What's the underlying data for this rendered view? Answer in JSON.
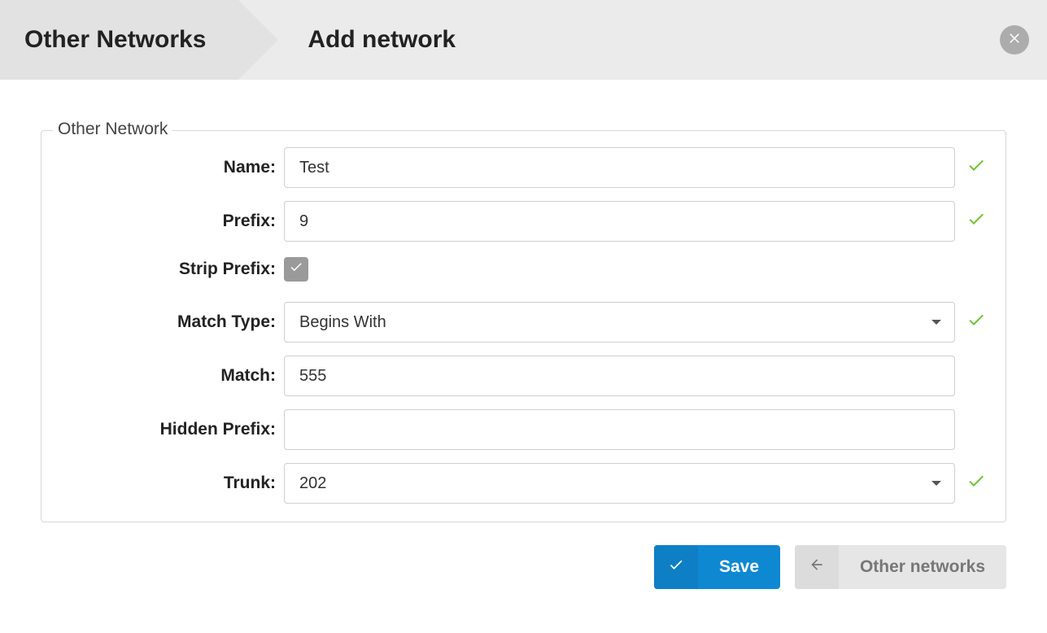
{
  "header": {
    "breadcrumb_root": "Other Networks",
    "breadcrumb_current": "Add network"
  },
  "fieldset": {
    "legend": "Other Network"
  },
  "form": {
    "name": {
      "label": "Name:",
      "value": "Test",
      "valid": true
    },
    "prefix": {
      "label": "Prefix:",
      "value": "9",
      "valid": true
    },
    "strip_prefix": {
      "label": "Strip Prefix:",
      "checked": true
    },
    "match_type": {
      "label": "Match Type:",
      "value": "Begins With",
      "valid": true
    },
    "match": {
      "label": "Match:",
      "value": "555"
    },
    "hidden_prefix": {
      "label": "Hidden Prefix:",
      "value": ""
    },
    "trunk": {
      "label": "Trunk:",
      "value": "202",
      "valid": true
    }
  },
  "actions": {
    "save": "Save",
    "back": "Other networks"
  }
}
